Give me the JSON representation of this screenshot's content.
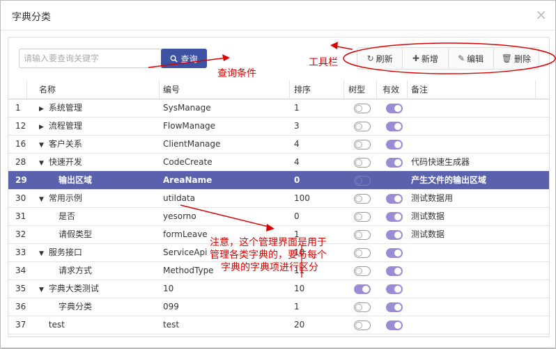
{
  "dialog": {
    "title": "字典分类",
    "close_glyph": "×"
  },
  "search": {
    "placeholder": "请输入要查询关键字",
    "query_label": "查询"
  },
  "toolbar": {
    "refresh_label": "刷新",
    "add_label": "新增",
    "edit_label": "编辑",
    "delete_label": "删除"
  },
  "annotations": {
    "toolbar_label": "工具栏",
    "query_label": "查询条件",
    "note_line1": "注意，这个管理界面是用于",
    "note_line2": "管理各类字典的，要与每个",
    "note_line3": "字典的字典项进行区分"
  },
  "table": {
    "columns": [
      "名称",
      "编号",
      "排序",
      "树型",
      "有效",
      "备注"
    ],
    "rows": [
      {
        "id": "1",
        "name": "系统管理",
        "caret": "▶",
        "indent": 0,
        "code": "SysManage",
        "sort": "1",
        "tree": false,
        "valid": true,
        "note": ""
      },
      {
        "id": "12",
        "name": "流程管理",
        "caret": "▶",
        "indent": 0,
        "code": "FlowManage",
        "sort": "3",
        "tree": false,
        "valid": true,
        "note": ""
      },
      {
        "id": "16",
        "name": "客户关系",
        "caret": "▼",
        "indent": 0,
        "code": "ClientManage",
        "sort": "4",
        "tree": false,
        "valid": true,
        "note": ""
      },
      {
        "id": "28",
        "name": "快速开发",
        "caret": "▼",
        "indent": 0,
        "code": "CodeCreate",
        "sort": "4",
        "tree": false,
        "valid": true,
        "note": "代码快速生成器"
      },
      {
        "id": "29",
        "name": "输出区域",
        "caret": "",
        "indent": 1,
        "code": "AreaName",
        "sort": "0",
        "tree": false,
        "valid": true,
        "note": "产生文件的输出区域",
        "selected": true
      },
      {
        "id": "30",
        "name": "常用示例",
        "caret": "▼",
        "indent": 0,
        "code": "utildata",
        "sort": "100",
        "tree": false,
        "valid": true,
        "note": "测试数据用"
      },
      {
        "id": "31",
        "name": "是否",
        "caret": "",
        "indent": 1,
        "code": "yesorno",
        "sort": "0",
        "tree": false,
        "valid": true,
        "note": "测试数据"
      },
      {
        "id": "32",
        "name": "请假类型",
        "caret": "",
        "indent": 1,
        "code": "formLeave",
        "sort": "1",
        "tree": false,
        "valid": true,
        "note": "测试数据"
      },
      {
        "id": "33",
        "name": "服务接口",
        "caret": "▼",
        "indent": 0,
        "code": "ServiceApi",
        "sort": "10",
        "tree": false,
        "valid": true,
        "note": ""
      },
      {
        "id": "34",
        "name": "请求方式",
        "caret": "",
        "indent": 1,
        "code": "MethodType",
        "sort": "11",
        "tree": false,
        "valid": true,
        "note": ""
      },
      {
        "id": "35",
        "name": "字典大类测试",
        "caret": "▼",
        "indent": 0,
        "code": "10",
        "sort": "10",
        "tree": true,
        "valid": true,
        "note": ""
      },
      {
        "id": "36",
        "name": "字典分类",
        "caret": "",
        "indent": 1,
        "code": "099",
        "sort": "1",
        "tree": false,
        "valid": true,
        "note": ""
      },
      {
        "id": "37",
        "name": "test",
        "caret": "",
        "indent": 0,
        "code": "test",
        "sort": "20",
        "tree": false,
        "valid": true,
        "note": ""
      }
    ]
  },
  "colors": {
    "accent": "#3d52a2",
    "selected_row": "#5a62ad",
    "toggle_on": "#9b8bd4",
    "annotation": "#dd0000"
  }
}
